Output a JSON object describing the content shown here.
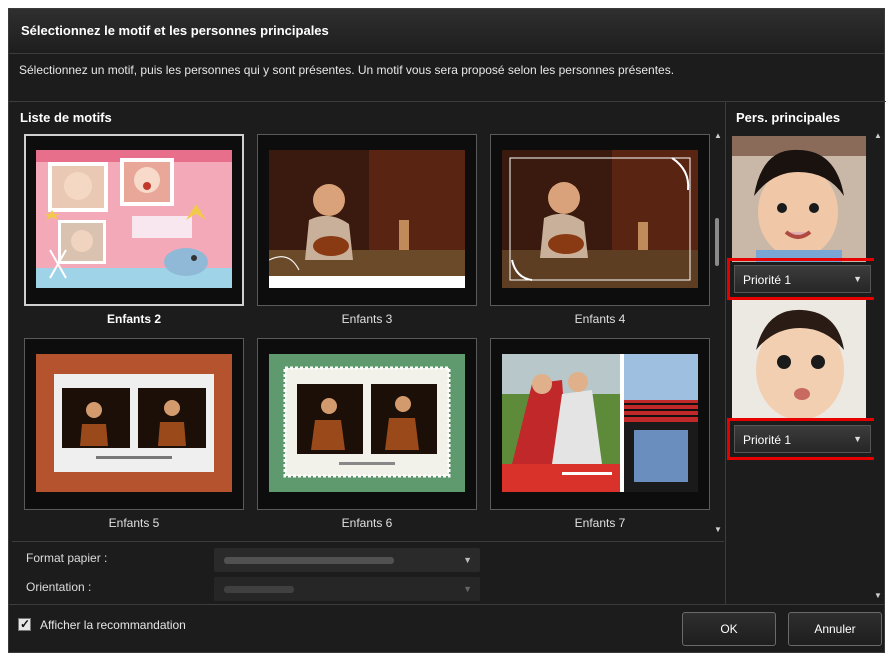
{
  "dialog": {
    "title": "Sélectionnez le motif et les personnes principales",
    "instruction": "Sélectionnez un motif, puis les personnes qui y sont présentes. Un motif vous sera proposé selon les personnes présentes."
  },
  "themes": {
    "section_label": "Liste de motifs",
    "items": [
      {
        "label": "Enfants 2",
        "selected": true
      },
      {
        "label": "Enfants 3",
        "selected": false
      },
      {
        "label": "Enfants 4",
        "selected": false
      },
      {
        "label": "Enfants 5",
        "selected": false
      },
      {
        "label": "Enfants 6",
        "selected": false
      },
      {
        "label": "Enfants 7",
        "selected": false
      }
    ]
  },
  "settings": {
    "paper_size_label": "Format papier :",
    "orientation_label": "Orientation :"
  },
  "people": {
    "section_label": "Pers. principales",
    "items": [
      {
        "priority": "Priorité 1"
      },
      {
        "priority": "Priorité 1"
      }
    ]
  },
  "footer": {
    "show_recommendation_label": "Afficher la recommandation",
    "show_recommendation_checked": true,
    "ok_label": "OK",
    "cancel_label": "Annuler"
  },
  "colors": {
    "highlight": "#e60000",
    "background": "#1c1c1c"
  }
}
